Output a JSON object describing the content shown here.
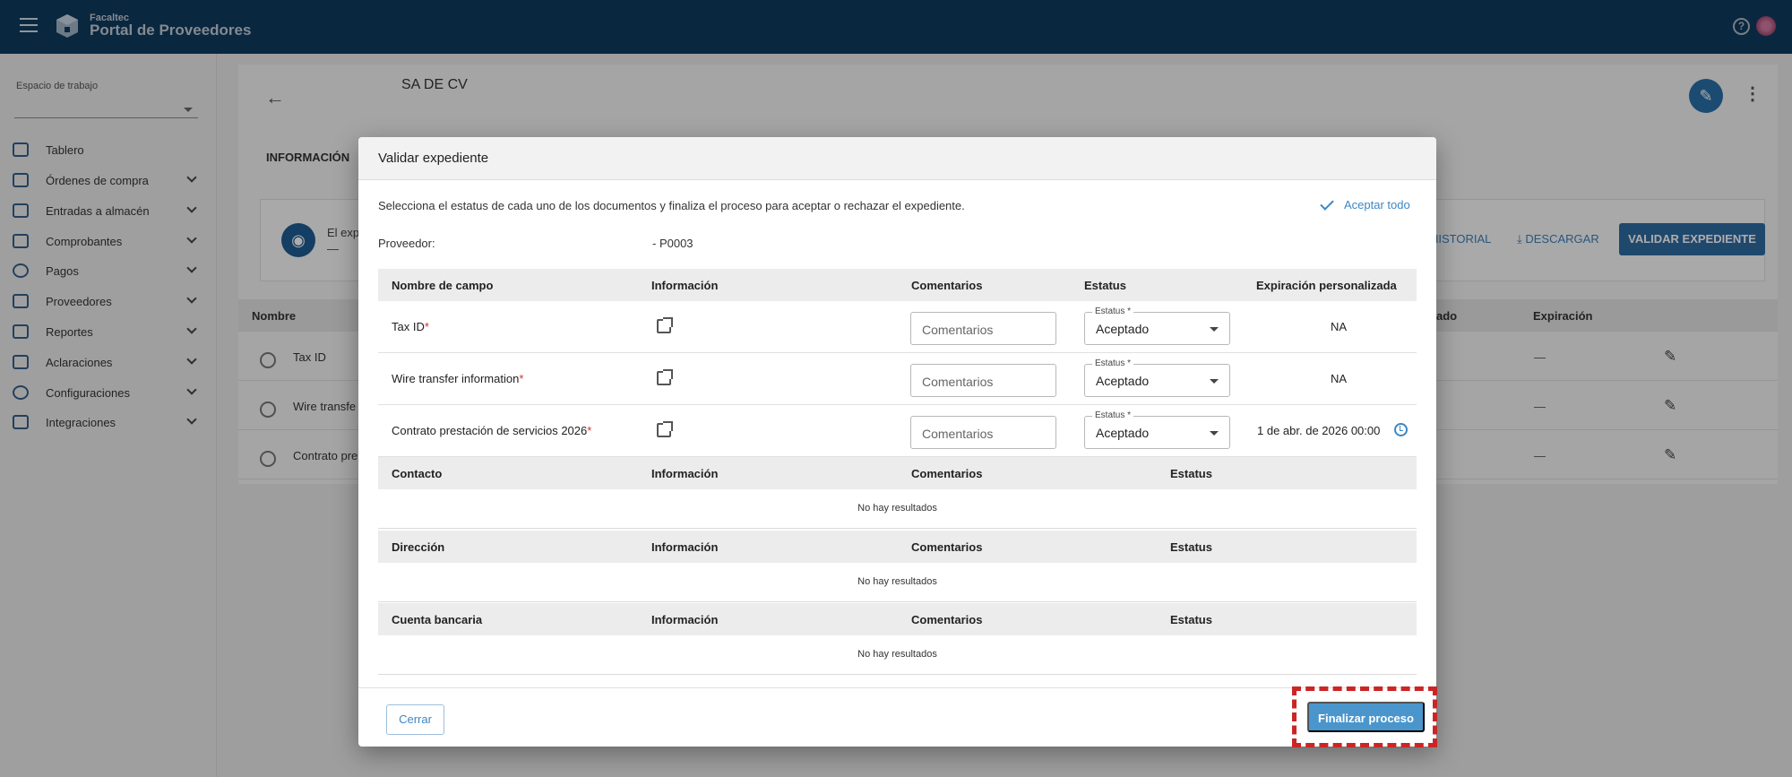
{
  "header": {
    "brand_small": "Facaltec",
    "brand_big": "Portal de Proveedores"
  },
  "sidebar": {
    "workspace_label": "Espacio de trabajo",
    "items": [
      {
        "label": "Tablero",
        "icon": "dashboard-icon",
        "expandable": false
      },
      {
        "label": "Órdenes de compra",
        "icon": "purchase-orders-icon",
        "expandable": true
      },
      {
        "label": "Entradas a almacén",
        "icon": "truck-icon",
        "expandable": true
      },
      {
        "label": "Comprobantes",
        "icon": "document-icon",
        "expandable": true
      },
      {
        "label": "Pagos",
        "icon": "dollar-icon",
        "expandable": true
      },
      {
        "label": "Proveedores",
        "icon": "building-icon",
        "expandable": true
      },
      {
        "label": "Reportes",
        "icon": "chart-icon",
        "expandable": true
      },
      {
        "label": "Aclaraciones",
        "icon": "mail-icon",
        "expandable": true
      },
      {
        "label": "Configuraciones",
        "icon": "gear-icon",
        "expandable": true
      },
      {
        "label": "Integraciones",
        "icon": "integrations-icon",
        "expandable": true
      }
    ]
  },
  "page": {
    "company": "SA DE CV",
    "tab_info": "INFORMACIÓN",
    "info_text": "El exp",
    "info_dash": "—",
    "historial": "HISTORIAL",
    "descargar": "DESCARGAR",
    "validar": "VALIDAR EXPEDIENTE",
    "table_headers": {
      "nombre": "Nombre",
      "ado": "ado",
      "expiracion": "Expiración"
    },
    "rows": [
      {
        "name": "Tax ID",
        "exp": "—"
      },
      {
        "name": "Wire transfe",
        "exp": "—"
      },
      {
        "name": "Contrato pre",
        "exp": "—"
      }
    ]
  },
  "modal": {
    "title": "Validar expediente",
    "description": "Selecciona el estatus de cada uno de los documentos y finaliza el proceso para aceptar o rechazar el expediente.",
    "accept_all": "Aceptar todo",
    "provider_label": "Proveedor:",
    "provider_value": "- P0003",
    "fields_headers": {
      "nombre": "Nombre de campo",
      "informacion": "Información",
      "comentarios": "Comentarios",
      "estatus": "Estatus",
      "expiracion": "Expiración personalizada"
    },
    "fields": [
      {
        "name": "Tax ID",
        "required": "*",
        "comment_placeholder": "Comentarios",
        "status_label": "Estatus *",
        "status": "Aceptado",
        "expiration": "NA"
      },
      {
        "name": "Wire transfer information",
        "required": "*",
        "comment_placeholder": "Comentarios",
        "status_label": "Estatus *",
        "status": "Aceptado",
        "expiration": "NA"
      },
      {
        "name": "Contrato prestación de servicios 2026",
        "required": "*",
        "comment_placeholder": "Comentarios",
        "status_label": "Estatus *",
        "status": "Aceptado",
        "expiration": "1 de abr. de 2026 00:00"
      }
    ],
    "sections": [
      {
        "title": "Contacto",
        "info": "Información",
        "comments": "Comentarios",
        "status": "Estatus",
        "empty": "No hay resultados"
      },
      {
        "title": "Dirección",
        "info": "Información",
        "comments": "Comentarios",
        "status": "Estatus",
        "empty": "No hay resultados"
      },
      {
        "title": "Cuenta bancaria",
        "info": "Información",
        "comments": "Comentarios",
        "status": "Estatus",
        "empty": "No hay resultados"
      }
    ],
    "close_label": "Cerrar",
    "finalize_label": "Finalizar proceso"
  },
  "colors": {
    "topbar": "#0e3a5e",
    "accent": "#3d87c4",
    "primary_button": "#4a96cc",
    "highlight": "#cc2525"
  }
}
